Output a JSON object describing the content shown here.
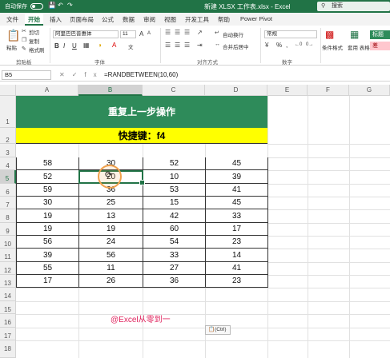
{
  "titlebar": {
    "autosave": "自动保存",
    "toggle_state": "关",
    "save_icon": "save-icon",
    "undo_icon": "undo-icon",
    "redo_icon": "redo-icon",
    "document_title": "新建 XLSX 工作表.xlsx - Excel",
    "search_placeholder": "搜索"
  },
  "tabs": [
    "文件",
    "开始",
    "插入",
    "页面布局",
    "公式",
    "数据",
    "审阅",
    "视图",
    "开发工具",
    "帮助",
    "Power Pivot"
  ],
  "active_tab": "开始",
  "ribbon": {
    "clipboard": {
      "paste": "粘贴",
      "cut": "剪切",
      "copy": "复制",
      "format_painter": "格式刷",
      "label": "剪贴板"
    },
    "font": {
      "font_name": "阿里巴巴普惠体",
      "font_size": "11",
      "bold": "B",
      "italic": "I",
      "underline": "U",
      "wen": "文",
      "grow": "A",
      "shrink": "A",
      "label": "字体"
    },
    "alignment": {
      "wrap": "自动换行",
      "merge": "合并后居中",
      "label": "对齐方式"
    },
    "number": {
      "format": "常规",
      "percent": "%",
      "comma": ",",
      "label": "数字"
    },
    "styles": {
      "conditional": "条件格式",
      "table": "套用\n表格格式",
      "tile1": "标题",
      "tile2": "差",
      "label": "样式"
    }
  },
  "formula_bar": {
    "name_box": "B5",
    "formula": "=RANDBETWEEN(10,60)",
    "cancel": "✕",
    "enter": "✓",
    "fx": "fx"
  },
  "sheet": {
    "columns": [
      "A",
      "B",
      "C",
      "D",
      "E",
      "F",
      "G"
    ],
    "rows": [
      "1",
      "2",
      "3",
      "4",
      "5",
      "6",
      "7",
      "8",
      "9",
      "10",
      "11",
      "12",
      "13",
      "14",
      "15",
      "16",
      "17",
      "18"
    ],
    "selected_cell": "B5",
    "title_banner": "重复上一步操作",
    "sub_banner": "快捷键：f4",
    "data": [
      [
        58,
        30,
        52,
        45
      ],
      [
        52,
        20,
        10,
        39
      ],
      [
        59,
        36,
        53,
        41
      ],
      [
        30,
        25,
        15,
        45
      ],
      [
        19,
        13,
        42,
        33
      ],
      [
        19,
        19,
        60,
        17
      ],
      [
        56,
        24,
        54,
        23
      ],
      [
        39,
        56,
        33,
        14
      ],
      [
        55,
        11,
        27,
        41
      ],
      [
        17,
        26,
        36,
        23
      ]
    ],
    "watermark": "@Excel从零到一",
    "paste_options": "(Ctrl)"
  },
  "colors": {
    "brand": "#217346",
    "banner": "#2e8b5a",
    "highlight": "#ffff00",
    "watermark": "#e0245e",
    "cursor": "#f0a04b"
  }
}
